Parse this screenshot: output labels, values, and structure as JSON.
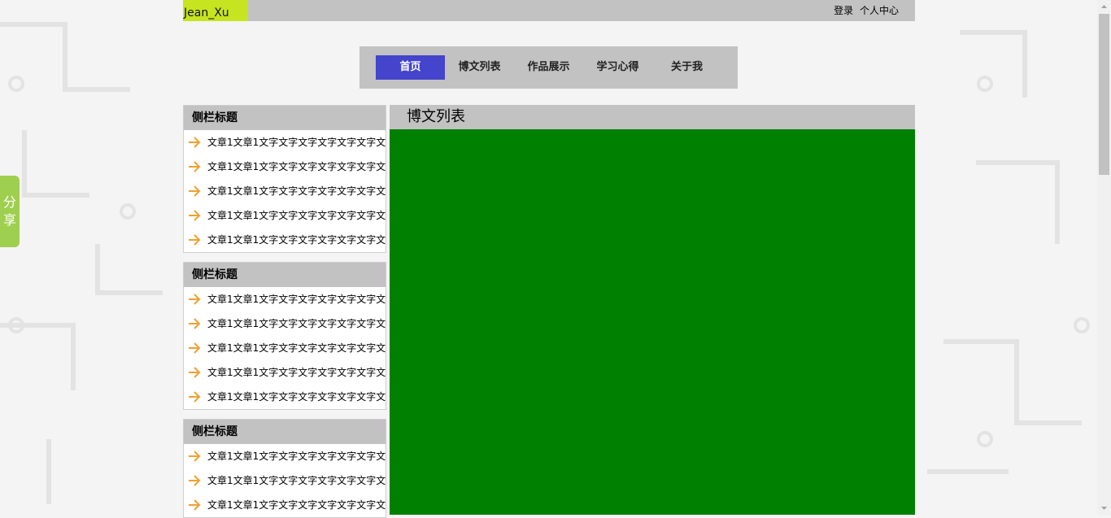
{
  "header": {
    "brand": "Jean_Xu",
    "links": [
      "登录",
      "个人中心"
    ]
  },
  "nav": {
    "items": [
      {
        "label": "首页",
        "active": true
      },
      {
        "label": "博文列表",
        "active": false
      },
      {
        "label": "作品展示",
        "active": false
      },
      {
        "label": "学习心得",
        "active": false
      },
      {
        "label": "关于我",
        "active": false
      }
    ]
  },
  "sidebar": {
    "widgets": [
      {
        "title": "侧栏标题",
        "items": [
          "文章1文章1文字文字文字文字文字文字文",
          "文章1文章1文字文字文字文字文字文字文",
          "文章1文章1文字文字文字文字文字文字文",
          "文章1文章1文字文字文字文字文字文字文",
          "文章1文章1文字文字文字文字文字文字文"
        ]
      },
      {
        "title": "侧栏标题",
        "items": [
          "文章1文章1文字文字文字文字文字文字文",
          "文章1文章1文字文字文字文字文字文字文",
          "文章1文章1文字文字文字文字文字文字文",
          "文章1文章1文字文字文字文字文字文字文",
          "文章1文章1文字文字文字文字文字文字文"
        ]
      },
      {
        "title": "侧栏标题",
        "items": [
          "文章1文章1文字文字文字文字文字文字文",
          "文章1文章1文字文字文字文字文字文字文",
          "文章1文章1文字文字文字文字文字文字文"
        ]
      }
    ]
  },
  "main": {
    "title": "博文列表"
  },
  "share": {
    "label": "分享"
  },
  "colors": {
    "brand_bg": "#c6e41f",
    "nav_active": "#4444cc",
    "content_bg": "#008000",
    "arrow": "#f0a030",
    "share_bg": "#9fcf4e"
  }
}
